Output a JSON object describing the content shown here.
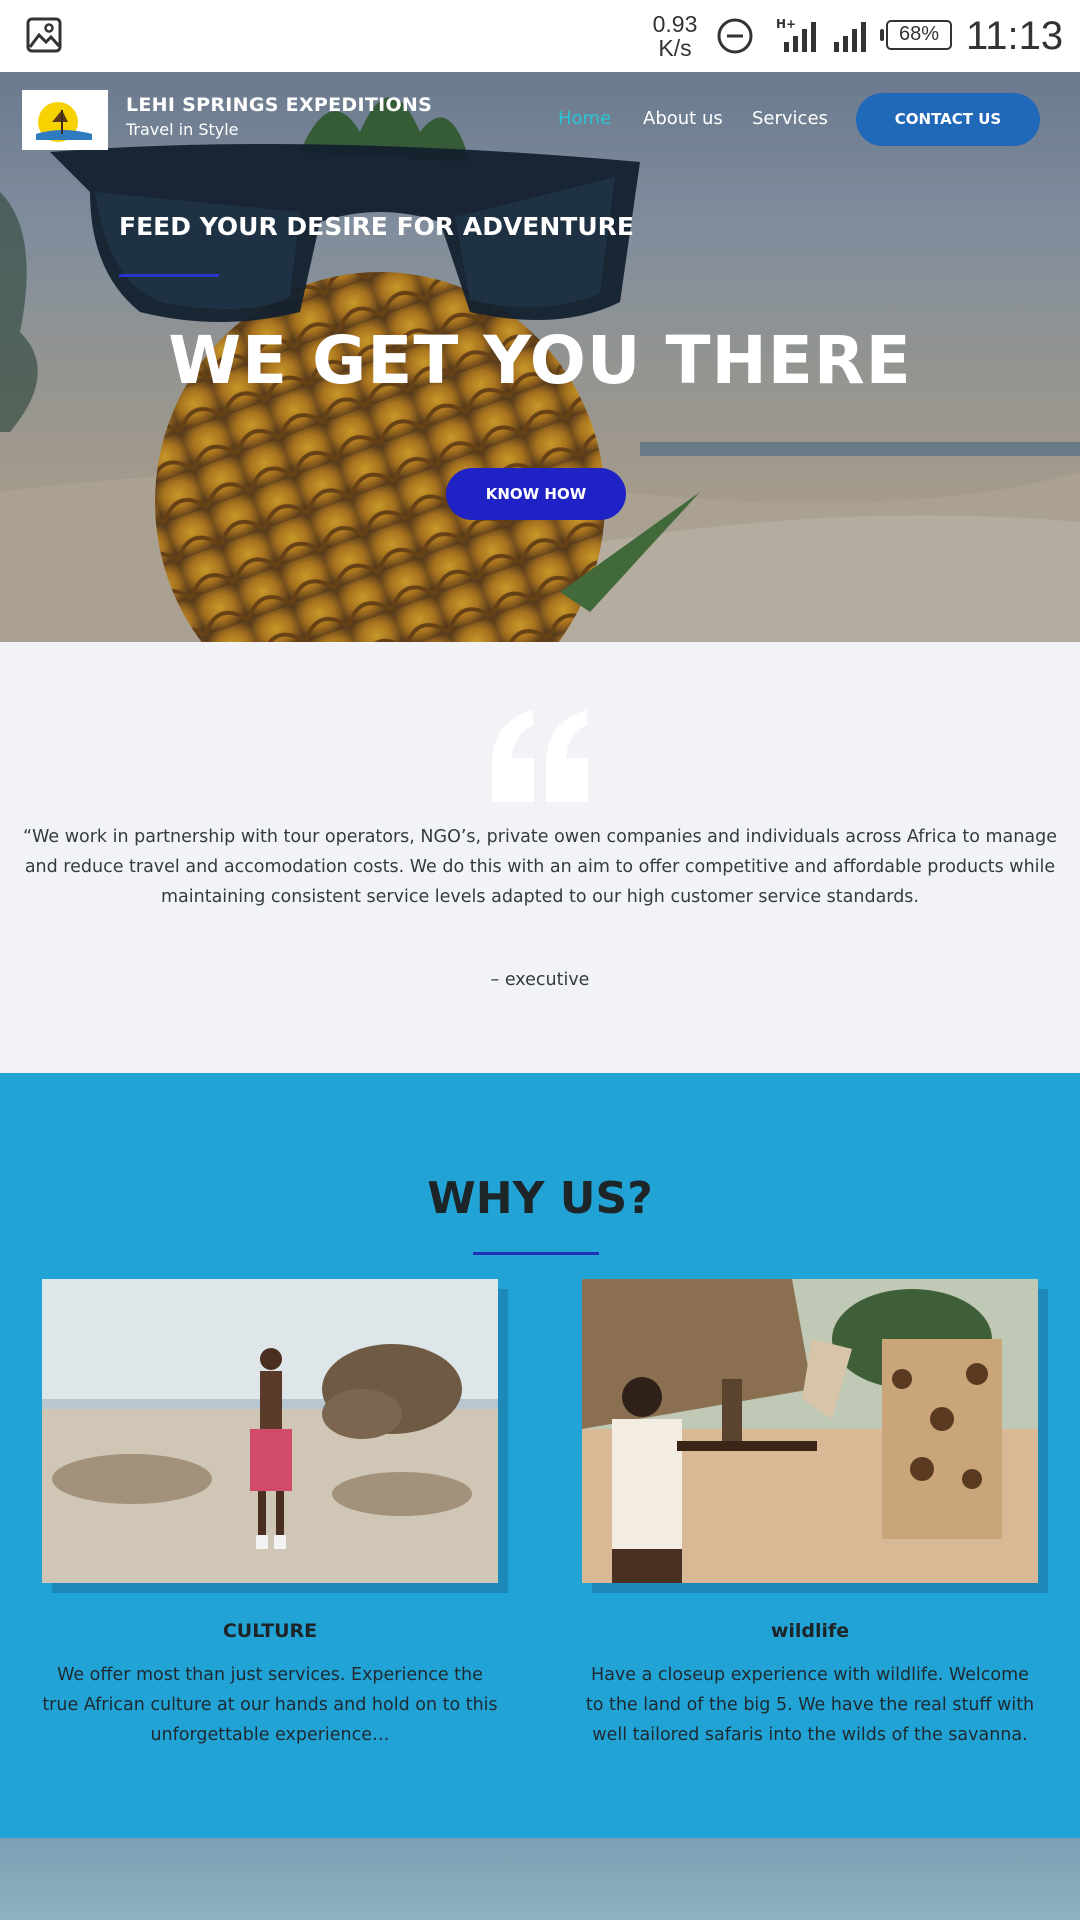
{
  "status_bar": {
    "net_speed": "0.93",
    "net_unit": "K/s",
    "battery": "68%",
    "time": "11:13",
    "icons": [
      "gallery-icon",
      "dnd-icon",
      "signal-icon",
      "battery-icon"
    ]
  },
  "header": {
    "brand_name": "LEHI SPRINGS EXPEDITIONS",
    "tagline": "Travel in Style",
    "nav": [
      "Home",
      "About us",
      "Services"
    ],
    "active_nav": "Home",
    "contact_label": "CONTACT US"
  },
  "hero": {
    "kicker": "FEED YOUR DESIRE FOR ADVENTURE",
    "title": "WE GET YOU THERE",
    "button_label": "KNOW HOW"
  },
  "testimonial": {
    "quote": "“We work in partnership with tour operators, NGO’s, private owen companies and individuals across Africa to manage and reduce travel and accomodation costs. We do this with an aim to offer competitive and affordable products while maintaining consistent service levels adapted to our high customer service standards.",
    "author": "– executive"
  },
  "why_us": {
    "title": "WHY US?",
    "cards": [
      {
        "title": "CULTURE",
        "text": "We offer most than just services. Experience the true African culture at our hands and hold on to this unforgettable experience…"
      },
      {
        "title": "wildlife",
        "text": "Have a closeup experience with wildlife. Welcome to the land of the big 5. We have the real stuff with well tailored safaris into the wilds of the savanna."
      }
    ]
  },
  "colors": {
    "nav_active": "#29c5d6",
    "contact_button": "#2068b8",
    "know_button": "#1f22c4",
    "section_blue": "#22a3d6",
    "accent_line": "#2230b8",
    "testimonial_bg": "#f2f3f7"
  }
}
